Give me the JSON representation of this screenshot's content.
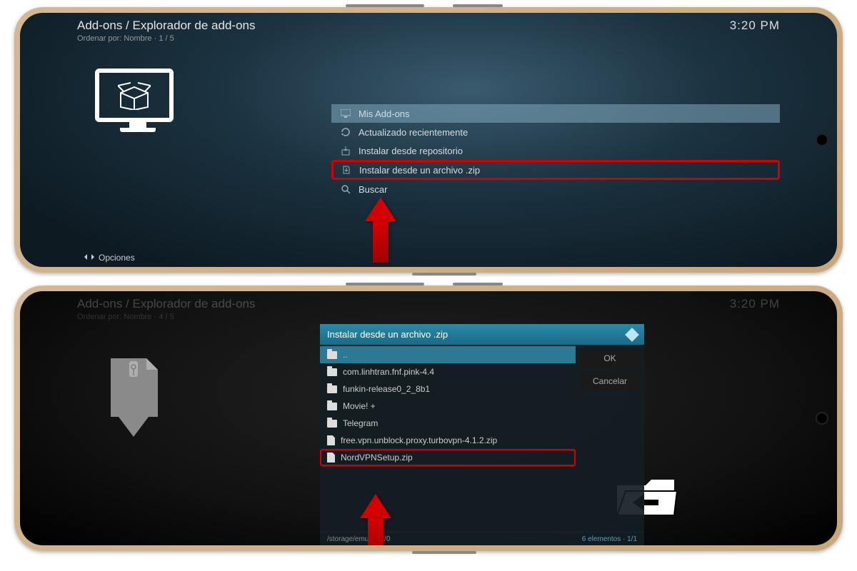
{
  "phone1": {
    "breadcrumb": "Add-ons / Explorador de add-ons",
    "sortline": "Ordenar por: Nombre  ·  1 / 5",
    "clock": "3:20 PM",
    "menu": {
      "my_addons": "Mis Add-ons",
      "recently_updated": "Actualizado recientemente",
      "install_repo": "Instalar desde repositorio",
      "install_zip": "Instalar desde un archivo .zip",
      "search": "Buscar"
    },
    "footer": "Opciones"
  },
  "phone2": {
    "breadcrumb": "Add-ons / Explorador de add-ons",
    "sortline": "Ordenar por: Nombre  ·  4 / 5",
    "clock": "3:20 PM",
    "dialog": {
      "title": "Instalar desde un archivo .zip",
      "ok": "OK",
      "cancel": "Cancelar",
      "path": "/storage/emulated/0",
      "count": "6 elementos · 1/1",
      "items": {
        "up": "..",
        "f1": "com.linhtran.fnf.pink-4.4",
        "f2": "funkin-release0_2_8b1",
        "f3": "Movie! +",
        "f4": "Telegram",
        "z1": "free.vpn.unblock.proxy.turbovpn-4.1.2.zip",
        "z2": "NordVPNSetup.zip"
      }
    }
  }
}
